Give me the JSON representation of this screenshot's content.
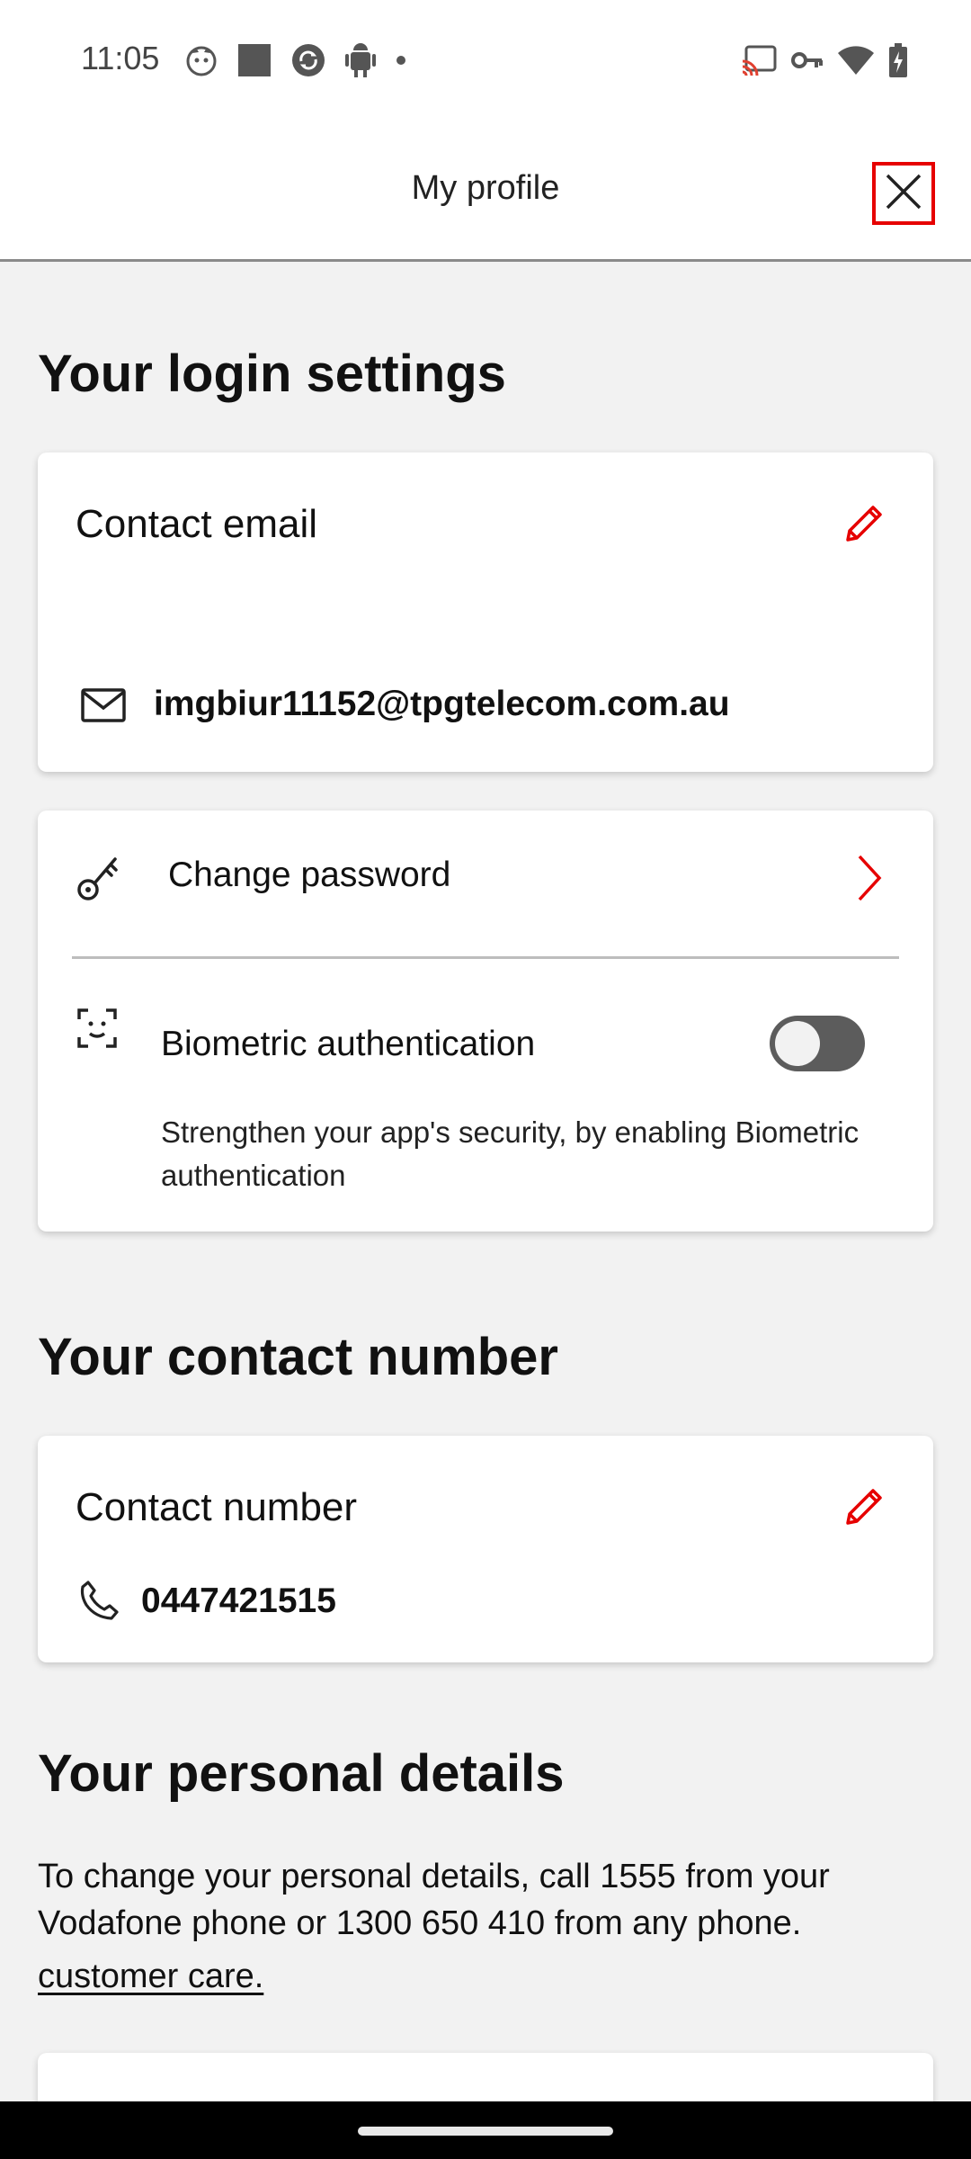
{
  "status_bar": {
    "time": "11:05",
    "left_icons": [
      "cat-face-icon",
      "square-icon",
      "sync-circle-icon",
      "android-robot-icon",
      "notification-dot-icon"
    ],
    "right_icons": [
      "cast-icon",
      "vpn-key-icon",
      "wifi-icon",
      "battery-charging-icon"
    ]
  },
  "header": {
    "title": "My profile",
    "close_icon": "close-icon"
  },
  "login_settings": {
    "heading": "Your login settings",
    "contact_email": {
      "title": "Contact email",
      "value": "imgbiur11152@tpgtelecom.com.au",
      "icon": "mail-icon",
      "edit_icon": "pencil-icon"
    },
    "change_password": {
      "label": "Change password",
      "icon": "key-icon",
      "chevron_icon": "chevron-right-icon"
    },
    "biometric": {
      "label": "Biometric authentication",
      "icon": "face-scan-icon",
      "enabled": false,
      "description": "Strengthen your app's security, by enabling Biometric authentication"
    }
  },
  "contact_number": {
    "heading": "Your contact number",
    "card_title": "Contact number",
    "value": "0447421515",
    "icon": "phone-icon",
    "edit_icon": "pencil-icon"
  },
  "personal_details": {
    "heading": "Your personal details",
    "description": "To change your personal details, call 1555 from your Vodafone phone or 1300 650 410 from any phone.",
    "link": "customer care."
  },
  "colors": {
    "accent": "#e60000",
    "background": "#f2f2f2",
    "card": "#ffffff",
    "text": "#111111",
    "toggle_off": "#5c5c5c"
  }
}
